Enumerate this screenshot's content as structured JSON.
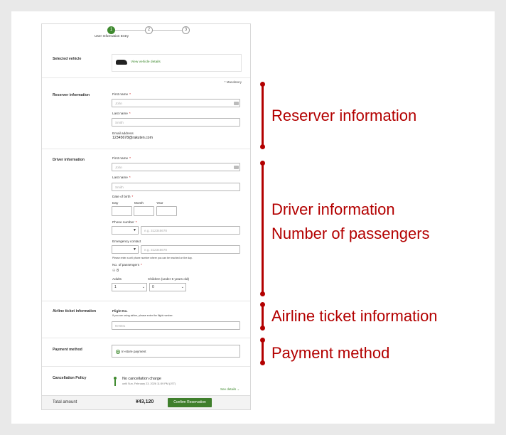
{
  "stepper": {
    "steps": [
      "1",
      "2",
      "3"
    ],
    "active_label": "User Information Entry"
  },
  "selected_vehicle": {
    "label": "Selected vehicle",
    "link": "View vehicle details"
  },
  "mandatory_note": "* Mandatory",
  "reserver": {
    "label": "Reserver information",
    "first_name_label": "First name",
    "first_name_placeholder": "John",
    "last_name_label": "Last name",
    "last_name_placeholder": "Smith",
    "email_label": "Email address",
    "email_value": "12345678@rakuten.com"
  },
  "driver": {
    "label": "Driver information",
    "first_name_label": "First name",
    "first_name_placeholder": "John",
    "last_name_label": "Last name",
    "last_name_placeholder": "Smith",
    "dob_label": "Date of birth",
    "day_label": "Day",
    "month_label": "Month",
    "year_label": "Year",
    "phone_label": "Phone number",
    "phone_placeholder": "e.g. 312345678",
    "emergency_label": "Emergency contact",
    "emergency_placeholder": "e.g. 312345678",
    "emergency_note": "Please enter a cell phone number where you can be reached on the day.",
    "passengers_label": "No. of passengers",
    "passengers_total": "8",
    "adults_label": "Adults",
    "adults_value": "1",
    "children_label": "Children (under 6 years old)",
    "children_value": "0"
  },
  "airline": {
    "label": "Airline ticket information",
    "flight_label": "Flight No.",
    "flight_note": "If you are using airline, please enter the flight number.",
    "flight_placeholder": "NH001"
  },
  "payment": {
    "label": "Payment method",
    "option": "In-store payment"
  },
  "cancellation": {
    "label": "Cancellation Policy",
    "title": "No cancellation charge",
    "detail": "until Sun, February 23, 2026 11:59 PM (JST)",
    "see_details": "See details"
  },
  "footer": {
    "total_label": "Total amount",
    "total_value": "¥43,120",
    "confirm_label": "Confirm Reservation"
  },
  "annotations": {
    "reserver": "Reserver information",
    "driver_line1": "Driver information",
    "driver_line2": "Number of passengers",
    "airline": "Airline ticket information",
    "payment": "Payment method"
  },
  "colors": {
    "accent_green": "#3f8a2f",
    "annotation_red": "#b30000"
  }
}
